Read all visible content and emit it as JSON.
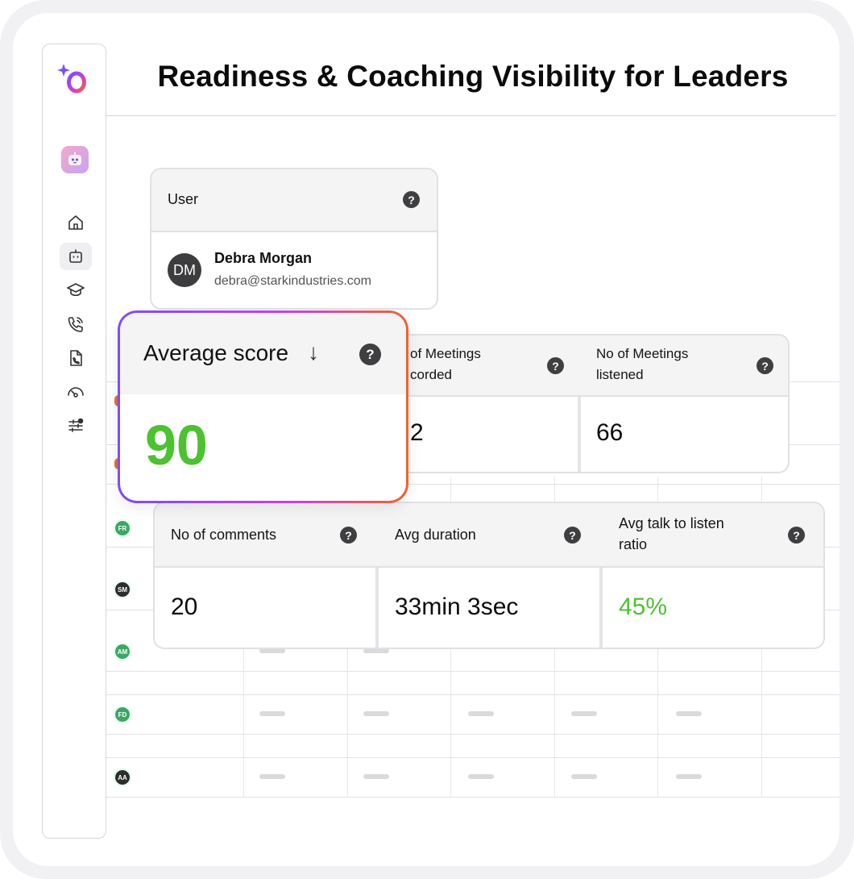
{
  "page": {
    "title": "Readiness & Coaching Visibility for Leaders"
  },
  "colors": {
    "accent_green": "#4cc230",
    "brand_gradient": [
      "#7a4dff",
      "#c53ff2",
      "#f2622d"
    ]
  },
  "sidebar": {
    "items": [
      {
        "icon": "home-icon"
      },
      {
        "icon": "bot-icon",
        "active": true
      },
      {
        "icon": "graduation-cap-icon"
      },
      {
        "icon": "phone-call-icon"
      },
      {
        "icon": "phone-document-icon"
      },
      {
        "icon": "gauge-icon"
      },
      {
        "icon": "sliders-icon"
      }
    ]
  },
  "user_card": {
    "header": "User",
    "help": "?",
    "initials": "DM",
    "name": "Debra Morgan",
    "email": "debra@starkindustries.com"
  },
  "score_card": {
    "label": "Average score",
    "arrow": "↓",
    "help": "?",
    "value": "90"
  },
  "meetings_card": {
    "col1_header": "of Meetings\ncorded",
    "col1_value": "2",
    "col2_header": "No of Meetings\nlistened",
    "col2_value": "66",
    "help": "?"
  },
  "stats_card": {
    "columns": [
      {
        "header": "No of comments",
        "value": "20"
      },
      {
        "header": "Avg duration",
        "value": "33min 3sec"
      },
      {
        "header": "Avg talk to listen\nratio",
        "value": "45%"
      }
    ],
    "help": "?"
  },
  "background_rows": [
    {
      "initials": "FR"
    },
    {
      "initials": "SM"
    },
    {
      "initials": "AM"
    },
    {
      "initials": "FD"
    },
    {
      "initials": "AA"
    }
  ]
}
